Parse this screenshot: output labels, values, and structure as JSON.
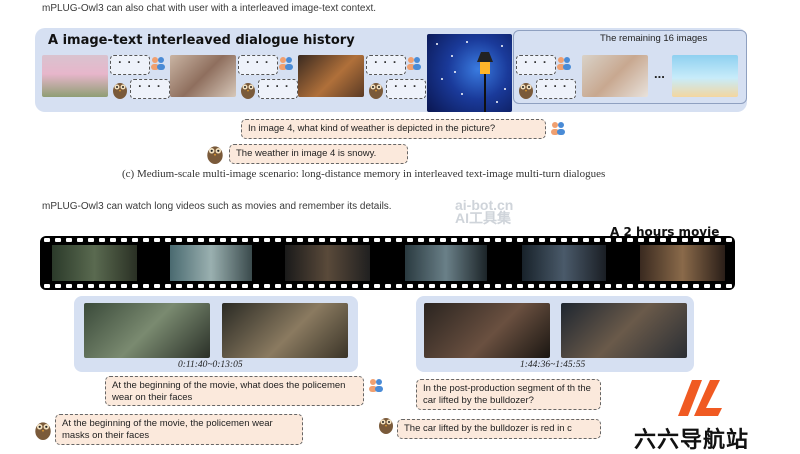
{
  "section1": {
    "intro": "mPLUG-Owl3 can also chat with user with a interleaved image-text context.",
    "panel_title": "A image-text interleaved dialogue history",
    "remaining_label": "The remaining 16 images",
    "ellipsis": "...",
    "placeholder": "· · ·",
    "question": "In image 4, what kind of weather is depicted in the picture?",
    "answer": "The weather in image 4 is snowy.",
    "caption": "(c) Medium-scale multi-image scenario: long-distance memory in interleaved text-image multi-turn dialogues"
  },
  "section2": {
    "intro": "mPLUG-Owl3 can watch long videos such as movies and remember its details.",
    "movie_title": "A 2 hours movie",
    "clip1": {
      "time": "0:11:40~0:13:05",
      "question": "At the beginning of the movie, what does the policemen wear on their faces",
      "answer": "At the beginning of the movie, the policemen wear masks on their faces"
    },
    "clip2": {
      "time": "1:44:36~1:45:55",
      "question": "In the post-production segment of th the car lifted by the bulldozer?",
      "answer": "The car lifted by the bulldozer is red in c"
    }
  },
  "watermark": {
    "line1": "ai-bot.cn",
    "line2": "AI工具集"
  },
  "logo": {
    "text": "六六导航站"
  },
  "colors": {
    "panel_bg": "#d6e0f2",
    "bubble_bg": "#fbe9dc",
    "logo_orange": "#f05a22"
  },
  "icons": [
    "person-icon",
    "owl-icon",
    "logo-mark-icon"
  ]
}
